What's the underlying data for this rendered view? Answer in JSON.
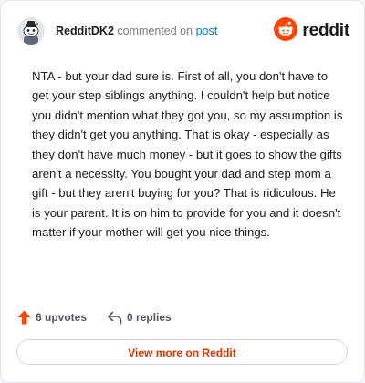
{
  "comment": {
    "author": "RedditDK2",
    "action_text": "commented on",
    "post_link": "post",
    "body": "NTA - but your dad sure is. First of all, you don't have to get your step siblings anything. I couldn't help but notice you didn't mention what they got you, so my assumption is they didn't get you anything. That is okay - especially as they don't have much money - but it goes to show the gifts aren't a necessity. You bought your dad and step mom a gift - but they aren't buying for you? That is ridiculous. He is your parent. It is on him to provide for you and it doesn't matter if your mother will get you nice things."
  },
  "brand": {
    "name": "reddit",
    "icon": "reddit-snoo-icon",
    "color": "#ff4500"
  },
  "avatar": {
    "icon": "snoo-avatar-icon"
  },
  "actions": {
    "upvotes_label": "6 upvotes",
    "upvote_icon": "upvote-arrow-icon",
    "upvote_color": "#ff4500",
    "replies_label": "0 replies",
    "reply_icon": "reply-arrow-icon"
  },
  "footer": {
    "view_more_label": "View more on Reddit",
    "view_more_color": "#d93900"
  }
}
